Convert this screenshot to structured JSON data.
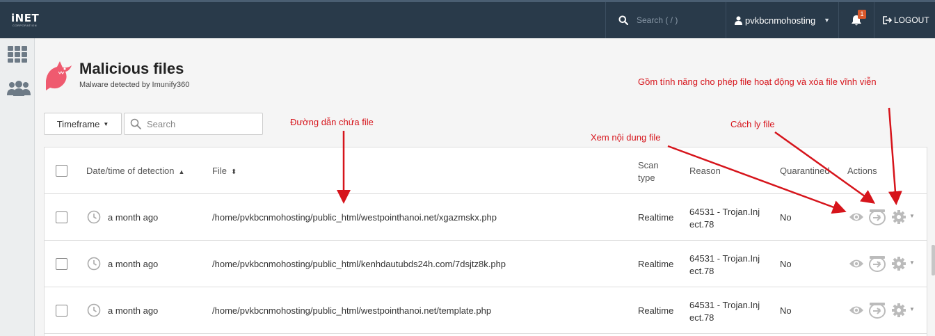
{
  "topbar": {
    "logo": "iNET",
    "logo_sub": "CORPORATION",
    "search_placeholder": "Search ( / )",
    "username": "pvkbcnmohosting",
    "notification_count": "1",
    "logout_label": "LOGOUT"
  },
  "page": {
    "title": "Malicious files",
    "subtitle": "Malware detected by Imunify360"
  },
  "filters": {
    "timeframe_label": "Timeframe",
    "search_placeholder": "Search"
  },
  "table": {
    "headers": {
      "date": "Date/time of detection",
      "file": "File",
      "scan_type_1": "Scan",
      "scan_type_2": "type",
      "reason": "Reason",
      "quarantined": "Quarantined",
      "actions": "Actions"
    },
    "rows": [
      {
        "time": "a month ago",
        "file": "/home/pvkbcnmohosting/public_html/westpointhanoi.net/xgazmskx.php",
        "scan_type": "Realtime",
        "reason_1": "64531 - Trojan.Inj",
        "reason_2": "ect.78",
        "quarantined": "No"
      },
      {
        "time": "a month ago",
        "file": "/home/pvkbcnmohosting/public_html/kenhdautubds24h.com/7dsjtz8k.php",
        "scan_type": "Realtime",
        "reason_1": "64531 - Trojan.Inj",
        "reason_2": "ect.78",
        "quarantined": "No"
      },
      {
        "time": "a month ago",
        "file": "/home/pvkbcnmohosting/public_html/westpointhanoi.net/template.php",
        "scan_type": "Realtime",
        "reason_1": "64531 - Trojan.Inj",
        "reason_2": "ect.78",
        "quarantined": "No"
      }
    ]
  },
  "annotations": {
    "file_path": "Đường dẫn chứa file",
    "view_content": "Xem nội dung file",
    "quarantine": "Cách ly file",
    "actions_menu": "Gồm tính năng cho phép file hoạt động và xóa file vĩnh viễn"
  },
  "colors": {
    "topbar": "#293a4a",
    "annotation": "#d6141b",
    "brand_icon": "#ef5a6f"
  }
}
